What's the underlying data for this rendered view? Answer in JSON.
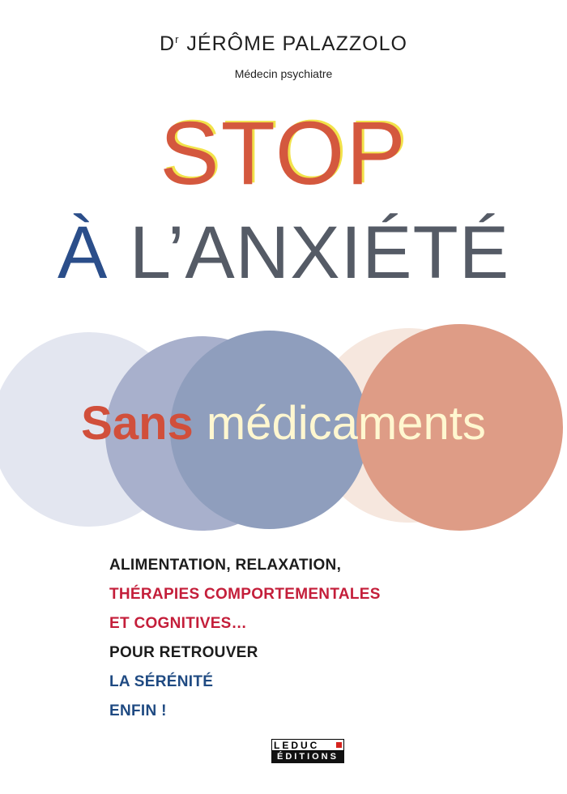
{
  "author": {
    "prefix": "D",
    "prefix_sup": "r",
    "name": "JÉRÔME PALAZZOLO",
    "role": "Médecin psychiatre"
  },
  "title": {
    "line1": "STOP",
    "line2_accent": "À",
    "line2_rest": " L’ANXIÉTÉ"
  },
  "subtitle": {
    "part1": "Sans",
    "part2": " médicaments"
  },
  "tagline": {
    "line1": "ALIMENTATION, RELAXATION,",
    "line2": "THÉRAPIES COMPORTEMENTALES",
    "line3": "ET COGNITIVES…",
    "line4": "POUR RETROUVER",
    "line5": "LA SÉRÉNITÉ",
    "line6": "ENFIN !"
  },
  "publisher": {
    "top": "LEDUC",
    "bottom": "ÉDITIONS"
  },
  "colors": {
    "title_red": "#d4583e",
    "title_gray": "#555b66",
    "accent_blue": "#2b4e8a",
    "tagline_red": "#c41e3a",
    "tagline_blue": "#1f4a82",
    "circle_pale_blue": "#e3e6f0",
    "circle_mid_blue": "#a8b0cc",
    "circle_blue": "#8f9ebd",
    "circle_peach": "#f6e7de",
    "circle_salmon": "#de9c86"
  }
}
